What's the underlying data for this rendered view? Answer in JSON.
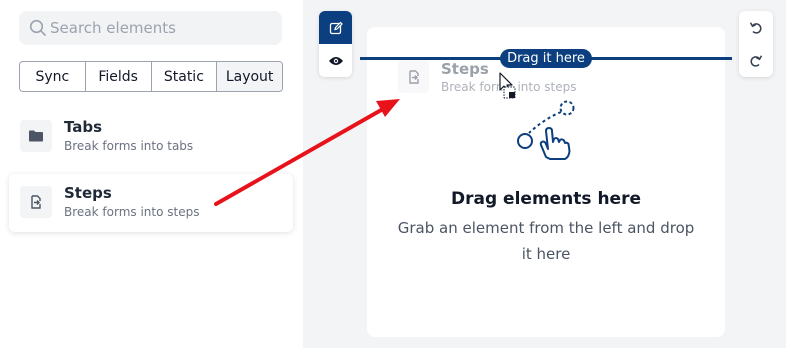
{
  "search": {
    "placeholder": "Search elements",
    "icon": "search-icon"
  },
  "category_tabs": [
    {
      "label": "Sync"
    },
    {
      "label": "Fields"
    },
    {
      "label": "Static"
    },
    {
      "label": "Layout"
    }
  ],
  "elements": [
    {
      "title": "Tabs",
      "description": "Break forms into tabs",
      "icon": "folder-icon"
    },
    {
      "title": "Steps",
      "description": "Break forms into steps",
      "icon": "steps-icon"
    }
  ],
  "builder": {
    "drop_indicator": "Drag it here",
    "dragged_element": {
      "title": "Steps",
      "description": "Break forms into steps"
    },
    "empty_title": "Drag elements here",
    "empty_subtitle": "Grab an element from the left and drop it here"
  },
  "colors": {
    "accent": "#0c3f7f",
    "arrow": "#e8121b",
    "canvas_bg": "#f3f4f6"
  }
}
